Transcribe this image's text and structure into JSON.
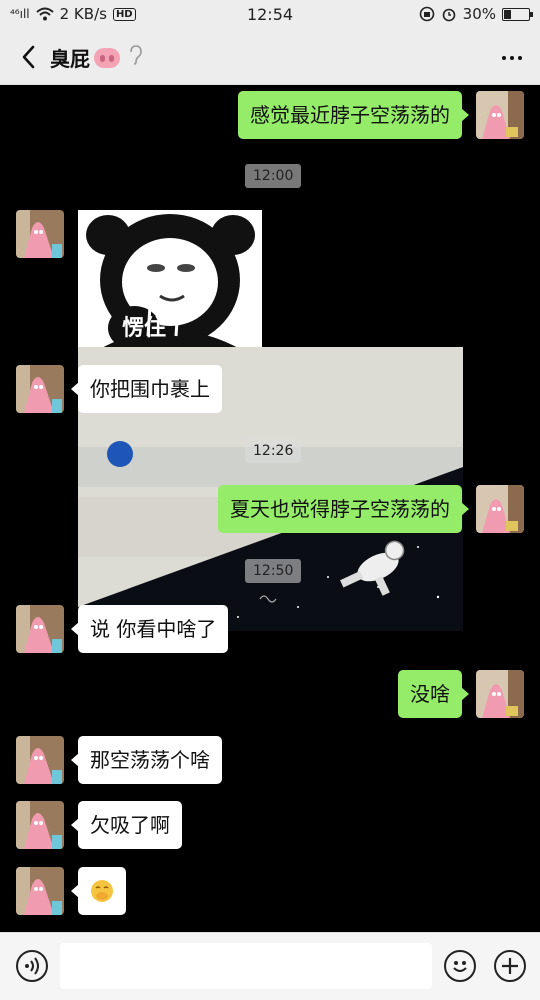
{
  "status": {
    "signal": "⁴⁶ıll",
    "speed": "2 KB/s",
    "hd": "HD",
    "time": "12:54",
    "battery": "30%",
    "battery_level": 0.3
  },
  "header": {
    "title": "臭屁"
  },
  "messages": {
    "m1": "感觉最近脖子空荡荡的",
    "t1": "12:00",
    "sticker_text": "愣住",
    "m2": "你把围巾裹上",
    "t2": "12:26",
    "m3": "夏天也觉得脖子空荡荡的",
    "t3": "12:50",
    "m4": "说 你看中啥了",
    "m5": "没啥",
    "m6": "那空荡荡个啥",
    "m7": "欠吸了啊",
    "m8": "🤭"
  },
  "colors": {
    "outgoing_bubble": "#95ec69",
    "incoming_bubble": "#ffffff",
    "chat_background": "#000000"
  },
  "icons": {
    "back": "chevron-left-icon",
    "ear": "ear-icon",
    "more": "more-dots-icon",
    "voice": "voice-icon",
    "emoji": "emoji-icon",
    "plus": "plus-icon"
  }
}
